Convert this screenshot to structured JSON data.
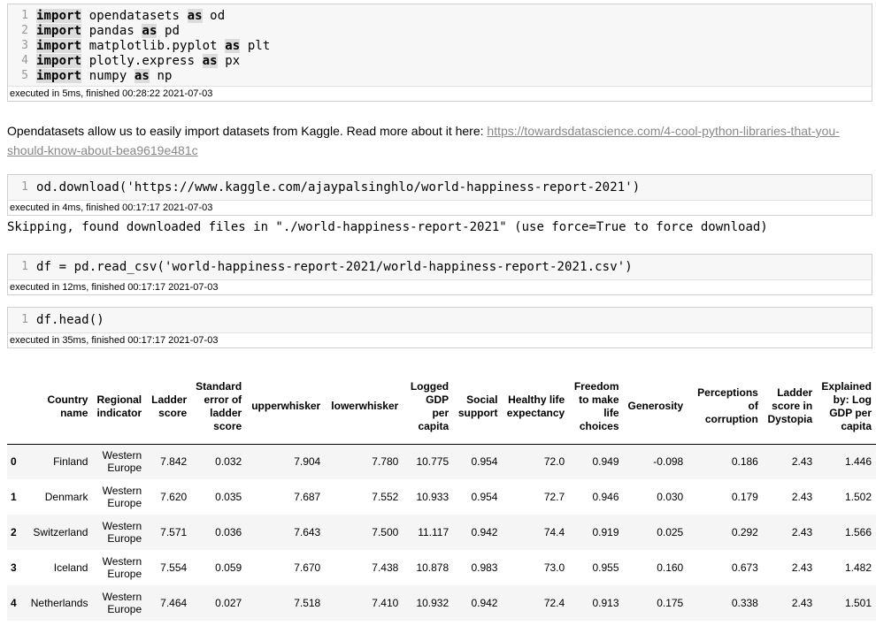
{
  "cell1": {
    "lines": [
      {
        "n": "1",
        "kw": "import",
        "mod": " opendatasets ",
        "as": "as",
        "alias": " od"
      },
      {
        "n": "2",
        "kw": "import",
        "mod": " pandas ",
        "as": "as",
        "alias": " pd"
      },
      {
        "n": "3",
        "kw": "import",
        "mod": " matplotlib.pyplot ",
        "as": "as",
        "alias": " plt"
      },
      {
        "n": "4",
        "kw": "import",
        "mod": " plotly.express ",
        "as": "as",
        "alias": " px"
      },
      {
        "n": "5",
        "kw": "import",
        "mod": " numpy ",
        "as": "as",
        "alias": " np"
      }
    ],
    "exec": "executed in 5ms, finished 00:28:22 2021-07-03"
  },
  "markdown": {
    "text": "Opendatasets allow us to easily import datasets from Kaggle. Read more about it here: ",
    "link": "https://towardsdatascience.com/4-cool-python-libraries-that-you-should-know-about-bea9619e481c"
  },
  "cell2": {
    "n": "1",
    "pre": "od.download(",
    "str": "'https://www.kaggle.com/ajaypalsinghlo/world-happiness-report-2021'",
    "post": ")",
    "exec": "executed in 4ms, finished 00:17:17 2021-07-03",
    "output": "Skipping, found downloaded files in \"./world-happiness-report-2021\" (use force=True to force download)"
  },
  "cell3": {
    "n": "1",
    "pre": "df = pd.read_csv(",
    "str": "'world-happiness-report-2021/world-happiness-report-2021.csv'",
    "post": ")",
    "exec": "executed in 12ms, finished 00:17:17 2021-07-03"
  },
  "cell4": {
    "n": "1",
    "src": "df.head()",
    "exec": "executed in 35ms, finished 00:17:17 2021-07-03"
  },
  "table": {
    "headers": [
      "",
      "Country name",
      "Regional indicator",
      "Ladder score",
      "Standard error of ladder score",
      "upperwhisker",
      "lowerwhisker",
      "Logged GDP per capita",
      "Social support",
      "Healthy life expectancy",
      "Freedom to make life choices",
      "Generosity",
      "Perceptions of corruption",
      "Ladder score in Dystopia",
      "Explained by: Log GDP per capita"
    ],
    "rows": [
      [
        "0",
        "Finland",
        "Western Europe",
        "7.842",
        "0.032",
        "7.904",
        "7.780",
        "10.775",
        "0.954",
        "72.0",
        "0.949",
        "-0.098",
        "0.186",
        "2.43",
        "1.446"
      ],
      [
        "1",
        "Denmark",
        "Western Europe",
        "7.620",
        "0.035",
        "7.687",
        "7.552",
        "10.933",
        "0.954",
        "72.7",
        "0.946",
        "0.030",
        "0.179",
        "2.43",
        "1.502"
      ],
      [
        "2",
        "Switzerland",
        "Western Europe",
        "7.571",
        "0.036",
        "7.643",
        "7.500",
        "11.117",
        "0.942",
        "74.4",
        "0.919",
        "0.025",
        "0.292",
        "2.43",
        "1.566"
      ],
      [
        "3",
        "Iceland",
        "Western Europe",
        "7.554",
        "0.059",
        "7.670",
        "7.438",
        "10.878",
        "0.983",
        "73.0",
        "0.955",
        "0.160",
        "0.673",
        "2.43",
        "1.482"
      ],
      [
        "4",
        "Netherlands",
        "Western Europe",
        "7.464",
        "0.027",
        "7.518",
        "7.410",
        "10.932",
        "0.942",
        "72.4",
        "0.913",
        "0.175",
        "0.338",
        "2.43",
        "1.501"
      ]
    ]
  }
}
